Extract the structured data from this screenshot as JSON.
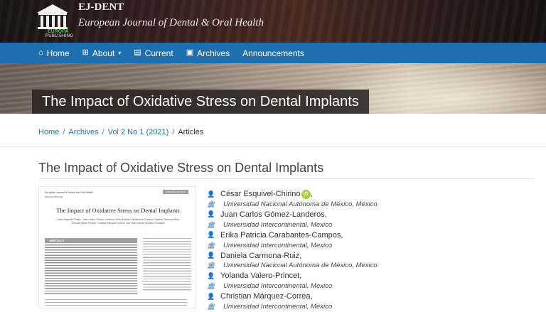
{
  "header": {
    "brand_short": "EJ-DENT",
    "brand_full": "European Journal of Dental & Oral Health",
    "logo_word": "EUROPA",
    "logo_sub": "PUBLISHING"
  },
  "nav": {
    "items": [
      {
        "label": "Home",
        "icon": "home-icon"
      },
      {
        "label": "About",
        "icon": "sitemap-icon",
        "dropdown": true
      },
      {
        "label": "Current",
        "icon": "current-icon"
      },
      {
        "label": "Archives",
        "icon": "archive-icon"
      },
      {
        "label": "Announcements"
      }
    ],
    "color": "#1e6fb0"
  },
  "hero": {
    "title": "The Impact of Oxidative Stress on Dental Implants"
  },
  "breadcrumb": {
    "items": [
      "Home",
      "Archives",
      "Vol 2 No 1 (2021)"
    ],
    "current": "Articles"
  },
  "article": {
    "title": "The Impact of Oxidative Stress on Dental Implants",
    "thumbnail": {
      "journal": "European Journal of Dental and Oral Health",
      "journal_url": "www.ej-dent.org",
      "badge": "ORIGINAL ARTICLE",
      "title": "The Impact of Oxidative Stress on Dental Implants",
      "authors": "César Esquivel-Chirino, Juan Carlos Gómez-Landeros, Erika Patricia Carabantes-Campos, Daniela Carmona-Ruiz, Yolanda Valero-Princet, Christian Márquez-Correa, and José Antonio Morales-González",
      "abstract_label": "ABSTRACT"
    },
    "authors": [
      {
        "name": "César Esquivel-Chirino",
        "orcid": true,
        "affiliation": "Universidad Nacional Autónoma de México, México"
      },
      {
        "name": "Juan Carlos Gómez-Landeros,",
        "affiliation": "Universidad Intercontinental, Mexico"
      },
      {
        "name": "Erika Patricia Carabantes-Campos,",
        "affiliation": "Universidad Intercontinental, Mexico"
      },
      {
        "name": "Daniela Carmona-Ruiz,",
        "affiliation": "Universidad Nacional Autónoma de México, Mexico"
      },
      {
        "name": "Yolanda Valero-Princet,",
        "affiliation": "Universidad Intercontinental, Mexico"
      },
      {
        "name": "Christian Márquez-Correa,",
        "affiliation": "Universidad Intercontinental, Mexico"
      }
    ],
    "orcid_label": "iD",
    "orcid_suffix": ","
  }
}
